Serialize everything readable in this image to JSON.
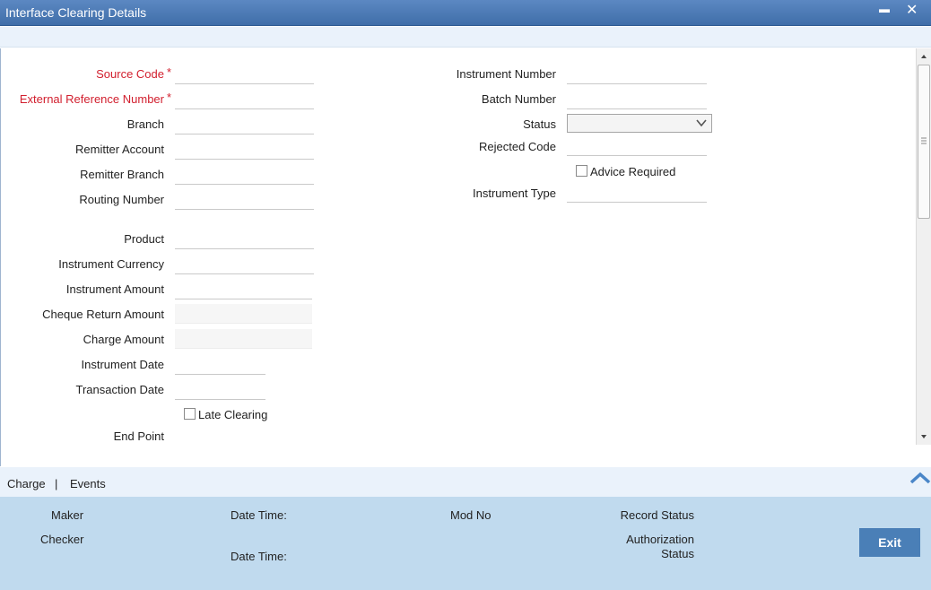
{
  "window": {
    "title": "Interface Clearing Details",
    "minimize_glyph": "▬",
    "close_glyph": "✕"
  },
  "left_form": {
    "source_code": {
      "label": "Source Code",
      "required_mark": "*",
      "value": ""
    },
    "external_reference_number": {
      "label": "External Reference Number",
      "required_mark": "*",
      "value": ""
    },
    "branch": {
      "label": "Branch",
      "value": ""
    },
    "remitter_account": {
      "label": "Remitter Account",
      "value": ""
    },
    "remitter_branch": {
      "label": "Remitter Branch",
      "value": ""
    },
    "routing_number": {
      "label": "Routing Number",
      "value": ""
    },
    "product": {
      "label": "Product",
      "value": ""
    },
    "instrument_currency": {
      "label": "Instrument Currency",
      "value": ""
    },
    "instrument_amount": {
      "label": "Instrument Amount",
      "value": ""
    },
    "cheque_return_amount": {
      "label": "Cheque Return Amount",
      "value": ""
    },
    "charge_amount": {
      "label": "Charge Amount",
      "value": ""
    },
    "instrument_date": {
      "label": "Instrument Date",
      "value": ""
    },
    "transaction_date": {
      "label": "Transaction Date",
      "value": ""
    },
    "late_clearing": {
      "label": "Late Clearing",
      "checked": false
    },
    "end_point": {
      "label": "End Point"
    }
  },
  "right_form": {
    "instrument_number": {
      "label": "Instrument Number",
      "value": ""
    },
    "batch_number": {
      "label": "Batch Number",
      "value": ""
    },
    "status": {
      "label": "Status",
      "selected": ""
    },
    "rejected_code": {
      "label": "Rejected Code",
      "value": ""
    },
    "advice_required": {
      "label": "Advice Required",
      "checked": false
    },
    "instrument_type": {
      "label": "Instrument Type",
      "value": ""
    }
  },
  "tabs": {
    "charge": "Charge",
    "separator": "|",
    "events": "Events"
  },
  "footer": {
    "maker": "Maker",
    "checker": "Checker",
    "date_time_1": "Date Time:",
    "date_time_2": "Date Time:",
    "mod_no": "Mod No",
    "record_status": "Record Status",
    "authorization_status_line1": "Authorization",
    "authorization_status_line2": "Status",
    "exit_label": "Exit"
  },
  "colors": {
    "title_bar": "#4a7ab5",
    "required_label": "#d2202f",
    "footer_bg": "#c0daee",
    "exit_button": "#4a7fb7"
  }
}
